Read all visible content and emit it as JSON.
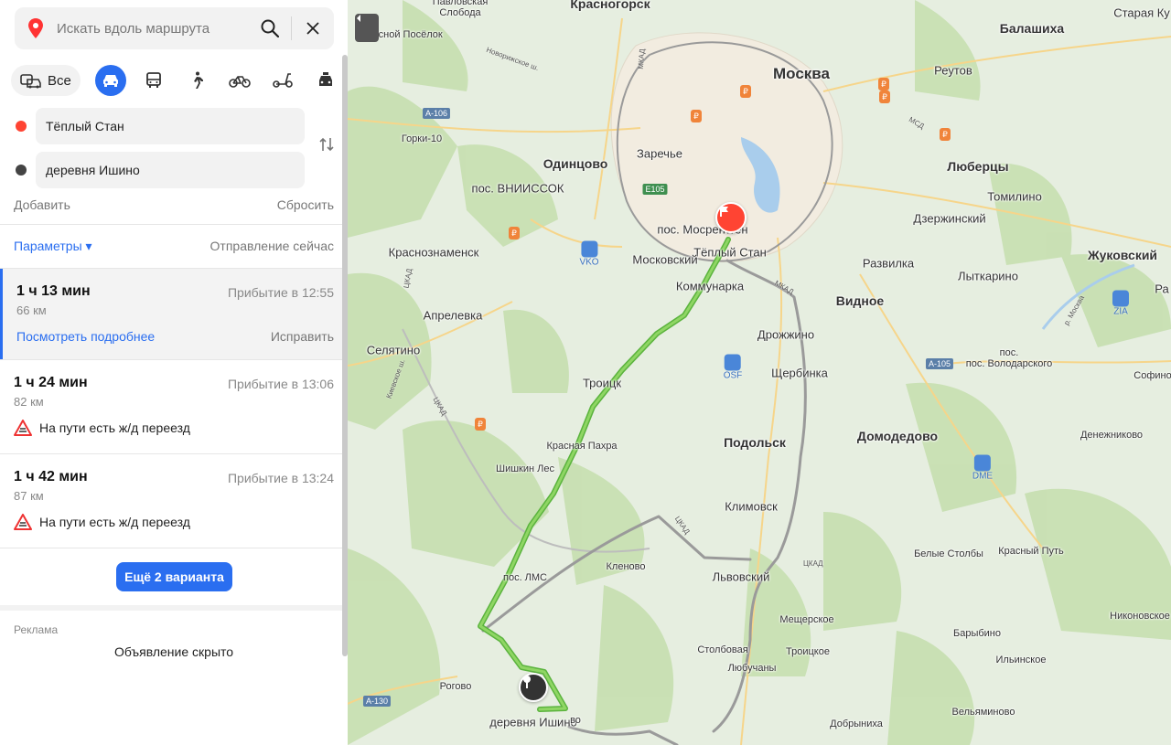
{
  "search": {
    "placeholder": "Искать вдоль маршрута"
  },
  "modes": {
    "all_label": "Все"
  },
  "route_points": {
    "from": "Тёплый Стан",
    "to": "деревня Ишино"
  },
  "actions": {
    "add": "Добавить",
    "reset": "Сбросить"
  },
  "params": {
    "label": "Параметры ▾",
    "departure": "Отправление сейчас"
  },
  "routes": [
    {
      "time": "1 ч 13 мин",
      "arrival": "Прибытие в 12:55",
      "distance": "66 км",
      "more": "Посмотреть подробнее",
      "fix": "Исправить"
    },
    {
      "time": "1 ч 24 мин",
      "arrival": "Прибытие в 13:06",
      "distance": "82 км",
      "warning": "На пути есть ж/д переезд"
    },
    {
      "time": "1 ч 42 мин",
      "arrival": "Прибытие в 13:24",
      "distance": "87 км",
      "warning": "На пути есть ж/д переезд"
    }
  ],
  "more_button": "Ещё 2 варианта",
  "ad": {
    "label": "Реклама",
    "hidden": "Объявление скрыто"
  },
  "colors": {
    "accent": "#2a6ef0",
    "route_green": "#7ccc4a",
    "route_alt": "#9a9a9a",
    "start_pin": "#ff4433",
    "end_pin": "#333333"
  },
  "map": {
    "labels": {
      "krasnogorsk": "Красногорск",
      "moskva": "Москва",
      "balashikha": "Балашиха",
      "reutov": "Реутов",
      "staraya": "Старая Ку",
      "pavlovskaya": "Павловская",
      "sloboda": "Слобода",
      "lesnoy": "Лесной Посёлок",
      "gorki": "Горки-10",
      "odintsovo": "Одинцово",
      "zarechye": "Заречье",
      "vniissok": "пос. ВНИИССОК",
      "lyubertsy": "Люберцы",
      "tomilino": "Томилино",
      "dzerzhinsky": "Дзержинский",
      "mosrentgen": "пос. Мосрентген",
      "teply": "Тёплый Стан",
      "krasnoznamensk": "Краснознаменск",
      "moskovsky": "Московский",
      "razvilka": "Развилка",
      "zhukovsky": "Жуковский",
      "lytkarino": "Лыткарино",
      "kommunarka": "Коммунарка",
      "vidnoe": "Видное",
      "aprelevka": "Апрелевка",
      "drozhzhino": "Дрожжино",
      "selyatino": "Селятино",
      "volodarskogo": "пос. Володарского",
      "pos": "пос.",
      "troitsk": "Троицк",
      "shcherbinka": "Щербинка",
      "sofino": "Софино",
      "krasnaya_pakhra": "Красная Пахра",
      "podolsk": "Подольск",
      "domodedovo": "Домодедово",
      "denezhnikovo": "Денежниково",
      "shishkin": "Шишкин Лес",
      "klimovsk": "Климовск",
      "belye": "Белые Столбы",
      "krasny_put": "Красный Путь",
      "lms": "пос. ЛМС",
      "klenovo": "Кленово",
      "lvovsky": "Львовский",
      "nikonovskoe": "Никоновское",
      "mescherskoe": "Мещерское",
      "barybino": "Барыбино",
      "stolbovaya": "Столбовая",
      "troitskoe": "Троицкое",
      "ilyinskoe": "Ильинское",
      "rogovo": "Рогово",
      "lyubuchany": "Любучаны",
      "velyaminovo": "Вельяминово",
      "ishino": "деревня Ишино",
      "vo": "во",
      "dobrynikha": "Добрыниха",
      "ra": "Ра"
    },
    "roads": {
      "a106": "А-106",
      "a105": "А-105",
      "a130": "А-130",
      "e105": "E105",
      "mkad": "МКАД",
      "ckad": "ЦКАД",
      "mcd": "МСД",
      "novorizhskoe": "Новорижское ш.",
      "kievskoe": "Киевское ш.",
      "r_moskva": "р. Москва"
    },
    "airports": {
      "vko": "VKO",
      "osf": "OSF",
      "dme": "DME",
      "zia": "ZIA"
    },
    "fuel_symbol": "₽"
  }
}
